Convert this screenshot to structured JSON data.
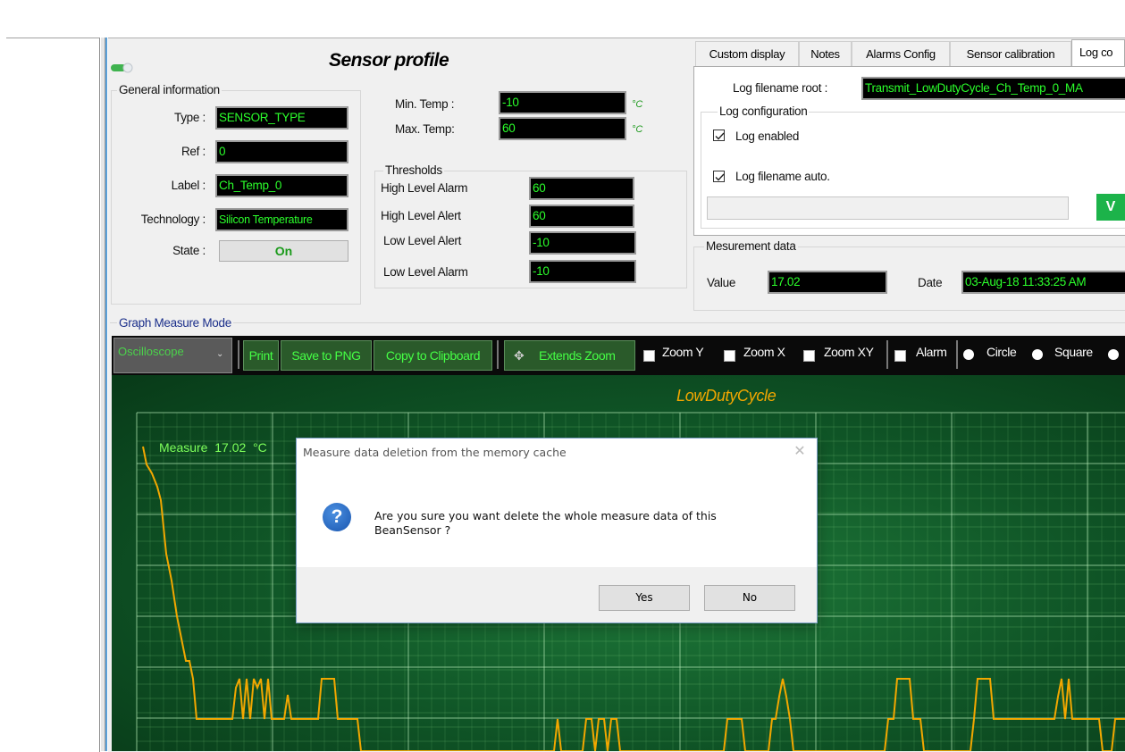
{
  "window": {
    "title": "Sensor profile"
  },
  "general": {
    "group_title": "General information",
    "type_label": "Type :",
    "type_value": "SENSOR_TYPE",
    "ref_label": "Ref :",
    "ref_value": "0",
    "label_label": "Label :",
    "label_value": "Ch_Temp_0",
    "technology_label": "Technology :",
    "technology_value": "Silicon Temperature",
    "state_label": "State :",
    "state_value": "On"
  },
  "temps": {
    "min_label": "Min. Temp :",
    "min_value": "-10",
    "min_unit": "°C",
    "max_label": "Max. Temp:",
    "max_value": "60",
    "max_unit": "°C"
  },
  "thresholds": {
    "title": "Thresholds",
    "rows": [
      {
        "label": "High Level Alarm",
        "value": "60"
      },
      {
        "label": "High Level Alert",
        "value": "60"
      },
      {
        "label": "Low Level Alert",
        "value": "-10"
      },
      {
        "label": "Low Level Alarm",
        "value": "-10"
      }
    ]
  },
  "tabs": [
    "Custom display",
    "Notes",
    "Alarms Config",
    "Sensor calibration",
    "Log co"
  ],
  "log": {
    "root_label": "Log filename root :",
    "root_value": "Transmit_LowDutyCycle_Ch_Temp_0_MA",
    "config_title": "Log configuration",
    "enabled_label": "Log enabled",
    "auto_label": "Log filename auto.",
    "btn_label": "V"
  },
  "measurement": {
    "title": "Mesurement data",
    "value_label": "Value",
    "value": "17.02",
    "date_label": "Date",
    "date": "03-Aug-18 11:33:25 AM"
  },
  "graph": {
    "group_title": "Graph Measure Mode",
    "mode_select": "Oscilloscope",
    "buttons": {
      "print": "Print",
      "save_png": "Save to PNG",
      "copy_clip": "Copy to Clipboard",
      "extends_zoom": "Extends Zoom"
    },
    "checks": [
      "Zoom Y",
      "Zoom X",
      "Zoom XY",
      "Alarm"
    ],
    "radios": [
      "Circle",
      "Square"
    ],
    "title": "LowDutyCycle",
    "measure_label": "Measure  17.02  °C"
  },
  "dialog": {
    "title": "Measure data deletion from the memory cache",
    "message_line1": "Are you sure you want delete the whole measure data of this",
    "message_line2": "BeanSensor ?",
    "yes": "Yes",
    "no": "No"
  },
  "colors": {
    "panel_bg": "#f0f0f0",
    "graph_bg": "#0d4a1d",
    "field_text": "#2bff2b",
    "trace": "#f2a700"
  }
}
